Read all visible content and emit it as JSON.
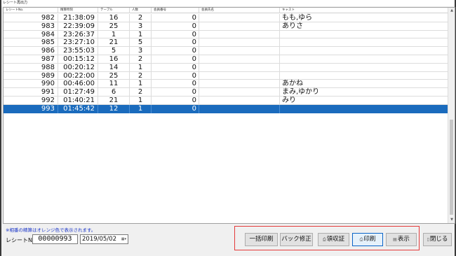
{
  "window": {
    "title": "レシート再出力"
  },
  "columns": [
    "レシートNo.",
    "精算時刻",
    "テーブル",
    "人数",
    "会員番号",
    "会員氏名",
    "キャスト"
  ],
  "rows": [
    {
      "no": "982",
      "time": "21:38:09",
      "table": "16",
      "people": "2",
      "member": "0",
      "name": "",
      "cast": "もも,ゆら"
    },
    {
      "no": "983",
      "time": "22:39:09",
      "table": "25",
      "people": "3",
      "member": "0",
      "name": "",
      "cast": "ありさ"
    },
    {
      "no": "984",
      "time": "23:26:37",
      "table": "1",
      "people": "1",
      "member": "0",
      "name": "",
      "cast": ""
    },
    {
      "no": "985",
      "time": "23:27:10",
      "table": "21",
      "people": "5",
      "member": "0",
      "name": "",
      "cast": ""
    },
    {
      "no": "986",
      "time": "23:55:03",
      "table": "5",
      "people": "3",
      "member": "0",
      "name": "",
      "cast": ""
    },
    {
      "no": "987",
      "time": "00:15:12",
      "table": "16",
      "people": "2",
      "member": "0",
      "name": "",
      "cast": ""
    },
    {
      "no": "988",
      "time": "00:20:12",
      "table": "14",
      "people": "1",
      "member": "0",
      "name": "",
      "cast": ""
    },
    {
      "no": "989",
      "time": "00:22:00",
      "table": "25",
      "people": "2",
      "member": "0",
      "name": "",
      "cast": ""
    },
    {
      "no": "990",
      "time": "00:46:00",
      "table": "11",
      "people": "1",
      "member": "0",
      "name": "",
      "cast": "あかね"
    },
    {
      "no": "991",
      "time": "01:27:49",
      "table": "6",
      "people": "2",
      "member": "0",
      "name": "",
      "cast": "まみ,ゆかり"
    },
    {
      "no": "992",
      "time": "01:40:21",
      "table": "21",
      "people": "1",
      "member": "0",
      "name": "",
      "cast": "みり"
    },
    {
      "no": "993",
      "time": "01:45:42",
      "table": "12",
      "people": "1",
      "member": "0",
      "name": "",
      "cast": ""
    }
  ],
  "selected_row_index": 11,
  "footer": {
    "note": "※相番の精算はオレンジ色で表示されます。",
    "receipt_label": "レシートNo.",
    "receipt_value": "00000993",
    "date_value": "2019/05/02"
  },
  "buttons": {
    "bulk_print": "一括印刷",
    "back_edit": "バック修正",
    "receipt": "領収証",
    "print": "印刷",
    "display": "表示",
    "close": "閉じる"
  },
  "colors": {
    "selection": "#1a6bbd",
    "note_text": "#1a35c7",
    "highlight_box": "#e43a3a"
  }
}
